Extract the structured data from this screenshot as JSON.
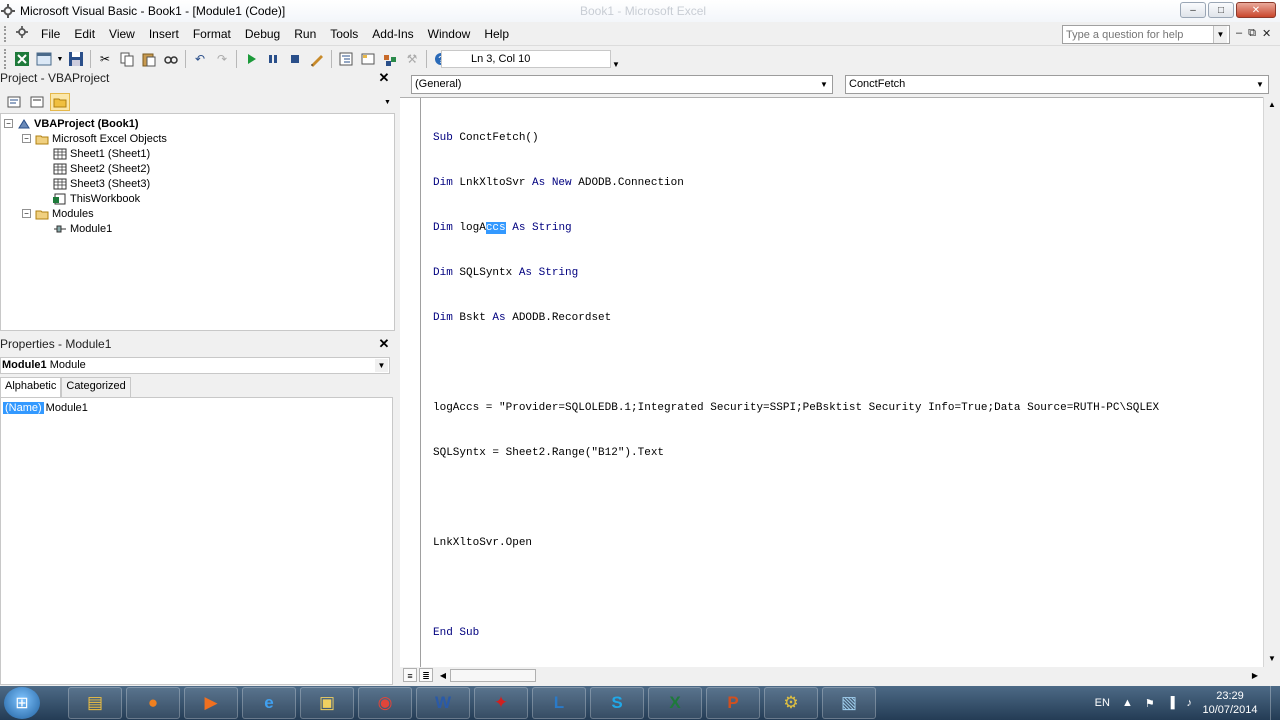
{
  "window": {
    "title": "Microsoft Visual Basic - Book1 - [Module1 (Code)]",
    "background_title": "Book1 - Microsoft Excel",
    "minimize_icon": "minimize-icon",
    "restore_icon": "restore-icon",
    "close_icon": "close-icon"
  },
  "menu": {
    "items": [
      "File",
      "Edit",
      "View",
      "Insert",
      "Format",
      "Debug",
      "Run",
      "Tools",
      "Add-Ins",
      "Window",
      "Help"
    ]
  },
  "help_box": {
    "placeholder": "Type a question for help"
  },
  "toolbar": {
    "position": "Ln 3, Col 10",
    "icons": [
      "view-excel-icon",
      "insert-userform-icon",
      "save-icon",
      "cut-icon",
      "copy-icon",
      "paste-icon",
      "find-icon",
      "undo-icon",
      "redo-icon",
      "run-icon",
      "break-icon",
      "reset-icon",
      "design-mode-icon",
      "project-explorer-icon",
      "properties-icon",
      "object-browser-icon",
      "toolbox-icon",
      "help-icon"
    ]
  },
  "project": {
    "title": "Project - VBAProject",
    "tree": [
      {
        "label": "VBAProject (Book1)",
        "bold": true,
        "icon": "vba-project-icon"
      },
      {
        "label": "Microsoft Excel Objects",
        "icon": "folder-icon"
      },
      {
        "label": "Sheet1 (Sheet1)",
        "icon": "sheet-icon"
      },
      {
        "label": "Sheet2 (Sheet2)",
        "icon": "sheet-icon"
      },
      {
        "label": "Sheet3 (Sheet3)",
        "icon": "sheet-icon"
      },
      {
        "label": "ThisWorkbook",
        "icon": "workbook-icon"
      },
      {
        "label": "Modules",
        "icon": "folder-icon"
      },
      {
        "label": "Module1",
        "icon": "module-icon"
      }
    ]
  },
  "properties": {
    "title": "Properties - Module1",
    "object_name": "Module1",
    "object_type": "Module",
    "tabs": [
      "Alphabetic",
      "Categorized"
    ],
    "row_key": "(Name)",
    "row_value": "Module1"
  },
  "code": {
    "object_combo": "(General)",
    "procedure_combo": "ConctFetch",
    "lines": [
      "Sub ConctFetch()",
      "Dim LnkXltoSvr As New ADODB.Connection",
      "Dim logAccs As String",
      "Dim SQLSyntx As String",
      "Dim Bskt As ADODB.Recordset",
      "",
      "logAccs = \"Provider=SQLOLEDB.1;Integrated Security=SSPI;PeBsktist Security Info=True;Data Source=RUTH-PC\\SQLEX",
      "SQLSyntx = Sheet2.Range(\"B12\").Text",
      "",
      "LnkXltoSvr.Open",
      "",
      "End Sub"
    ]
  },
  "taskbar": {
    "apps": [
      "explorer-icon",
      "firefox-icon",
      "media-player-icon",
      "internet-explorer-icon",
      "folder-icon",
      "chrome-icon",
      "word-icon",
      "acrobat-icon",
      "lync-icon",
      "skype-icon",
      "excel-icon",
      "powerpoint-icon",
      "network-icon",
      "notepad-icon"
    ],
    "language": "EN",
    "time": "23:29",
    "date": "10/07/2014"
  },
  "colors": {
    "keyword": "#00007f",
    "selection": "#3399ff"
  }
}
